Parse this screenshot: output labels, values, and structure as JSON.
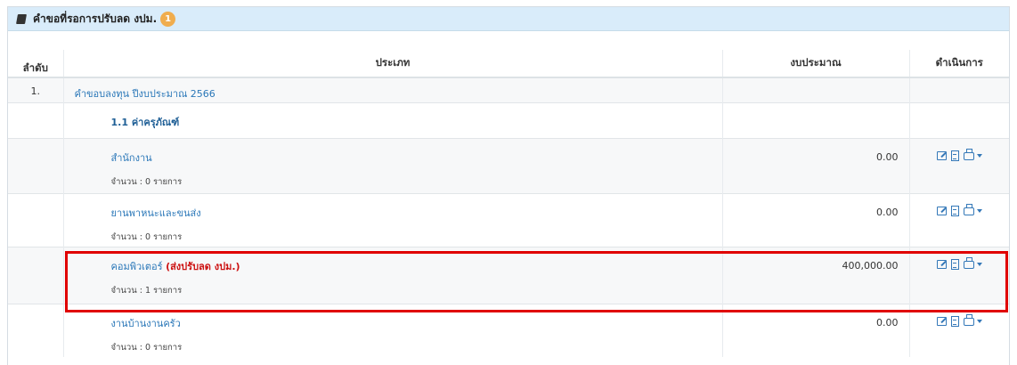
{
  "panel": {
    "title": "คำขอที่รอการปรับลด งปม.",
    "badge": "1",
    "icon": "book-icon"
  },
  "table": {
    "headers": {
      "no": "ลำดับ",
      "type": "ประเภท",
      "budget": "งบประมาณ",
      "action": "ดำเนินการ"
    },
    "group_no": "1.",
    "group_label": "คำขอบลงทุน ปีงบประมาณ 2566",
    "subgroup_label": "1.1 ค่าครุภัณฑ์",
    "items": [
      {
        "name": "สำนักงาน",
        "flag": "",
        "count": "จำนวน : 0 รายการ",
        "amount": "0.00"
      },
      {
        "name": "ยานพาหนะและขนส่ง",
        "flag": "",
        "count": "จำนวน : 0 รายการ",
        "amount": "0.00"
      },
      {
        "name": "คอมพิวเตอร์",
        "flag": "(ส่งปรับลด งปม.)",
        "count": "จำนวน : 1 รายการ",
        "amount": "400,000.00"
      },
      {
        "name": "งานบ้านงานครัว",
        "flag": "",
        "count": "จำนวน : 0 รายการ",
        "amount": "0.00"
      }
    ]
  },
  "colors": {
    "header_bg": "#d9ecfa",
    "badge": "#f0ad4e",
    "link": "#2a77b8",
    "highlight": "#e00000"
  }
}
